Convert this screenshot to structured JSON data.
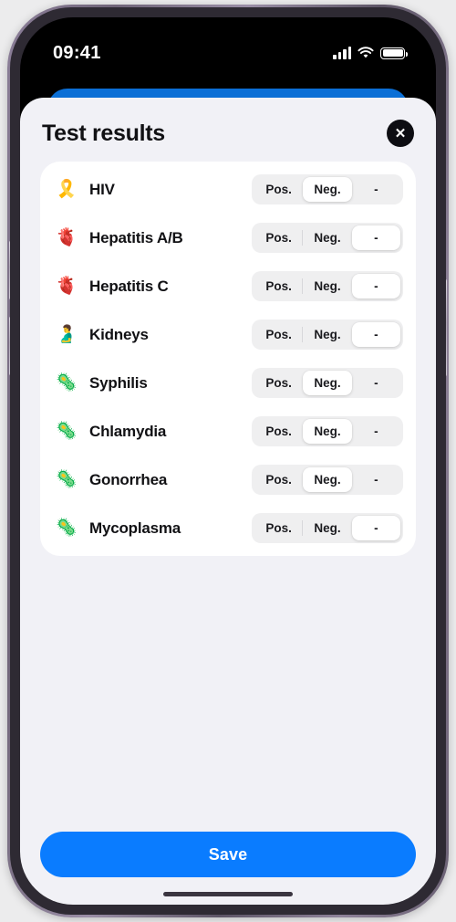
{
  "status_bar": {
    "time": "09:41",
    "signal_icon": "cellular-signal-icon",
    "wifi_icon": "wifi-icon",
    "battery_icon": "battery-icon"
  },
  "sheet": {
    "title": "Test results",
    "close_label": "✕"
  },
  "segment_options": [
    "Pos.",
    "Neg.",
    "-"
  ],
  "rows": [
    {
      "icon": "🎗️",
      "icon_name": "red-ribbon-icon",
      "label": "HIV",
      "selected": 1
    },
    {
      "icon": "🫀",
      "icon_name": "liver-icon",
      "label": "Hepatitis A/B",
      "selected": 2
    },
    {
      "icon": "🫀",
      "icon_name": "liver-icon",
      "label": "Hepatitis C",
      "selected": 2
    },
    {
      "icon": "🫃",
      "icon_name": "kidneys-icon",
      "label": "Kidneys",
      "selected": 2
    },
    {
      "icon": "🦠",
      "icon_name": "microbe-icon",
      "label": "Syphilis",
      "selected": 1
    },
    {
      "icon": "🦠",
      "icon_name": "microbe-icon",
      "label": "Chlamydia",
      "selected": 1
    },
    {
      "icon": "🦠",
      "icon_name": "microbe-icon",
      "label": "Gonorrhea",
      "selected": 1
    },
    {
      "icon": "🦠",
      "icon_name": "microbe-icon",
      "label": "Mycoplasma",
      "selected": 2
    }
  ],
  "footer": {
    "save_label": "Save"
  },
  "colors": {
    "accent_blue": "#0a7cff",
    "peek_blue": "#0b6fd6",
    "sheet_bg": "#f1f1f6",
    "card_bg": "#ffffff",
    "segment_track": "#efeff0",
    "text_primary": "#111114"
  }
}
